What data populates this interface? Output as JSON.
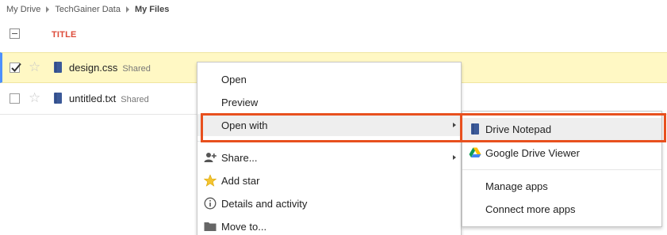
{
  "breadcrumb": {
    "items": [
      "My Drive",
      "TechGainer Data",
      "My Files"
    ]
  },
  "list_header": {
    "title_column": "TITLE"
  },
  "files": [
    {
      "name": "design.css",
      "badge": "Shared",
      "selected": true,
      "starred": false
    },
    {
      "name": "untitled.txt",
      "badge": "Shared",
      "selected": false,
      "starred": false
    }
  ],
  "context_menu": {
    "items": [
      {
        "label": "Open"
      },
      {
        "label": "Preview"
      },
      {
        "label": "Open with",
        "has_submenu": true,
        "highlighted": true
      },
      {
        "label": "Share...",
        "icon": "add-person-icon",
        "has_submenu": true
      },
      {
        "label": "Add star",
        "icon": "star-icon"
      },
      {
        "label": "Details and activity",
        "icon": "info-icon"
      },
      {
        "label": "Move to...",
        "icon": "folder-icon"
      }
    ]
  },
  "open_with_submenu": {
    "items": [
      {
        "label": "Drive Notepad",
        "icon": "notepad-doc-icon",
        "highlighted": true
      },
      {
        "label": "Google Drive Viewer",
        "icon": "google-drive-icon"
      },
      {
        "label": "Manage apps"
      },
      {
        "label": "Connect more apps"
      }
    ]
  },
  "colors": {
    "accent_red": "#dd4b39",
    "selection_yellow": "#fff8c4",
    "selection_border": "#4d90fe",
    "callout_orange": "#e8501e",
    "doc_blue": "#3b5998"
  }
}
